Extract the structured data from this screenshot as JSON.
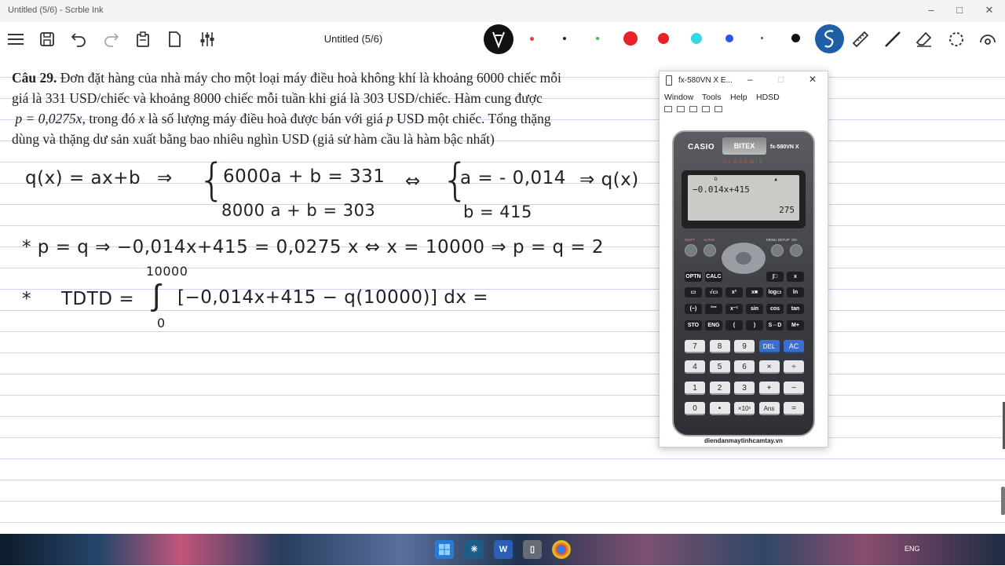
{
  "window": {
    "title": "Untitled (5/6) - Scrble Ink",
    "min": "–",
    "max": "□",
    "close": "✕"
  },
  "toolbar": {
    "doc_title": "Untitled (5/6)",
    "pen_colors": [
      "#e63946",
      "#222222",
      "#3cbf4a",
      "#e8212b",
      "#e8212b",
      "#36d6e7",
      "#2458e6",
      "#555555",
      "#111111"
    ],
    "tool_icons": [
      "menu-icon",
      "save-icon",
      "undo-icon",
      "redo-icon",
      "clipboard-icon",
      "page-icon",
      "settings-sliders-icon",
      "pen-tool-icon",
      "lasso-pen-icon",
      "ruler-icon",
      "line-icon",
      "eraser-icon",
      "select-icon",
      "view-icon"
    ],
    "active_color": "#1f5fa8"
  },
  "problem": {
    "label": "Câu 29.",
    "line1": "Đơn đặt hàng của nhà máy cho một loại máy điều hoà không khí là khoảng 6000 chiếc mỗi",
    "line2": "giá là 331 USD/chiếc và khoảng 8000 chiếc mỗi tuần khi giá là 303 USD/chiếc. Hàm cung được",
    "line3_eq": "p = 0,0275x",
    "line3_a": ", trong đó",
    "line3_x": "x",
    "line3_b": "là số lượng máy điều hoà được bán với giá",
    "line3_p": "p",
    "line3_c": "USD một chiếc. Tổng thặng",
    "line4": "dùng và thặng dư sản xuất bằng bao nhiêu nghìn USD (giả sử hàm cầu là hàm bậc nhất)"
  },
  "handwriting": {
    "eq1": "q(x) = ax+b",
    "arrow1": "⇒",
    "sys1_top": "6000a + b = 331",
    "sys1_bot": "8000 a + b = 303",
    "iff1": "⇔",
    "sys2_top": "a = - 0,014",
    "sys2_bot": "b = 415",
    "arrow2": "⇒ q(x)",
    "line2": "*  p = q ⇒ −0,014x+415 = 0,0275 x ⇔ x = 10000 ⇒  p = q = 2",
    "line3_star": "*",
    "line3_lhs": "TDTD =",
    "int_upper": "10000",
    "int_lower": "0",
    "int_body": "[−0,014x+415 − q(10000)] dx ="
  },
  "calc_window": {
    "title": "fx-580VN X E...",
    "menu": [
      "Window",
      "Tools",
      "Help",
      "HDSD"
    ],
    "brand": "CASIO",
    "sub_brand": "BITEX",
    "model": "fx-580VN X",
    "series": "CLASSWIZ",
    "display_expr": "−0.014x+415",
    "display_result": "275",
    "display_indicator": "D",
    "display_cursor": "▲",
    "website": "diendanmaytinhcamtay.vn",
    "top_row": [
      "OPTN",
      "CALC",
      "∫□",
      "x"
    ],
    "func_row1": [
      "▭",
      "√▭",
      "x²",
      "x■",
      "log▭",
      "ln"
    ],
    "func_row2": [
      "(−)",
      "°'\"",
      "x⁻¹",
      "sin",
      "cos",
      "tan"
    ],
    "func_row3": [
      "STO",
      "ENG",
      "(",
      ")",
      "S⇔D",
      "M+"
    ],
    "num_row1": [
      "7",
      "8",
      "9",
      "DEL",
      "AC"
    ],
    "num_row2": [
      "4",
      "5",
      "6",
      "×",
      "÷"
    ],
    "num_row3": [
      "1",
      "2",
      "3",
      "+",
      "−"
    ],
    "num_row4": [
      "0",
      "•",
      "×10ˣ",
      "Ans",
      "="
    ],
    "small_labels": [
      "SHIFT",
      "ALPHA",
      "MENU SETUP",
      "ON"
    ]
  },
  "taskbar": {
    "apps": [
      "windows-start-icon",
      "snowflake-app-icon",
      "word-icon",
      "calculator-app-icon",
      "chrome-icon"
    ],
    "lang": "ENG"
  }
}
